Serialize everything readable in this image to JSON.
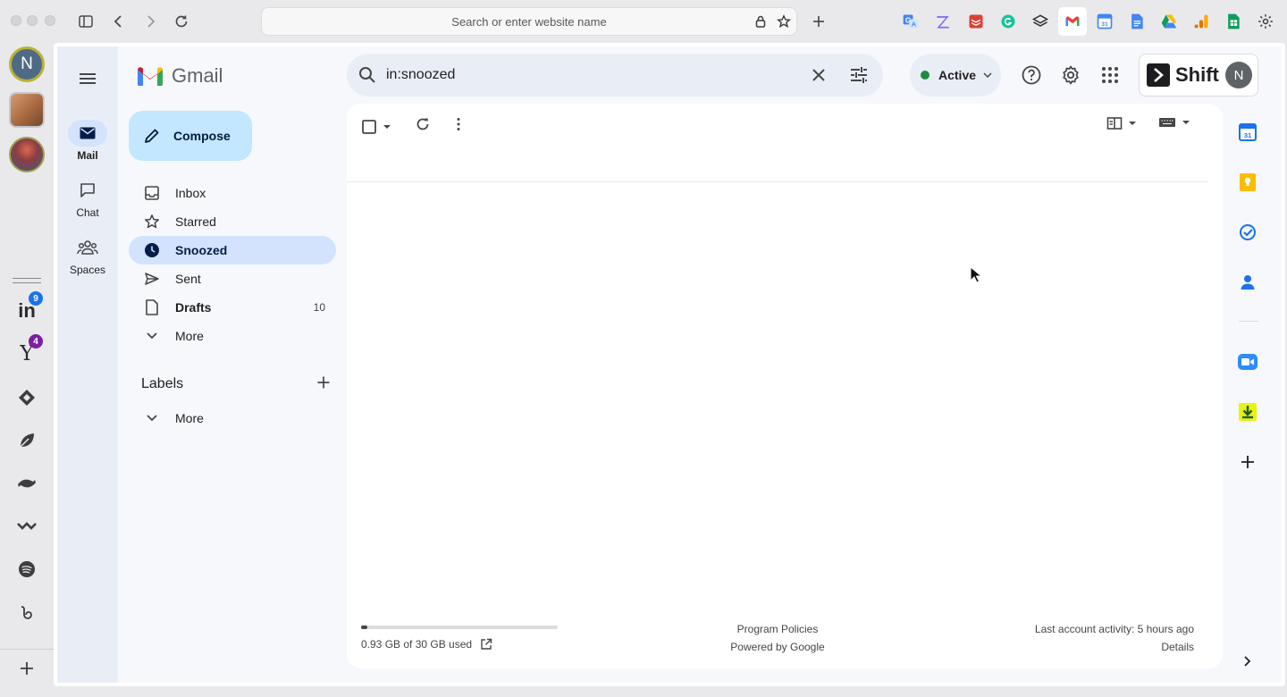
{
  "browser": {
    "url_placeholder": "Search or enter website name",
    "buttons": [
      "sidebar-toggle-icon",
      "back-icon",
      "forward-icon",
      "reload-icon",
      "lock-icon",
      "star-icon",
      "new-tab-icon",
      "settings-icon"
    ],
    "extensions": [
      "translate-icon",
      "clickup-icon",
      "todoist-icon",
      "grammarly-icon",
      "layers-icon",
      "gmail-icon",
      "calendar-icon",
      "docs-icon",
      "drive-icon",
      "analytics-icon",
      "sheets-icon"
    ]
  },
  "shift_rail": {
    "account_initial": "N",
    "apps": [
      {
        "name": "linkedin",
        "text": "in",
        "badge": "9",
        "badge_color": "#1a73e8"
      },
      {
        "name": "yahoo",
        "text": "Y",
        "badge": "4",
        "badge_color": "#7b1fa2"
      }
    ]
  },
  "gmail": {
    "logo_text": "Gmail",
    "app_nav": [
      {
        "label": "Mail"
      },
      {
        "label": "Chat"
      },
      {
        "label": "Spaces"
      }
    ],
    "compose_label": "Compose",
    "folders": [
      {
        "label": "Inbox",
        "count": ""
      },
      {
        "label": "Starred",
        "count": ""
      },
      {
        "label": "Snoozed",
        "count": ""
      },
      {
        "label": "Sent",
        "count": ""
      },
      {
        "label": "Drafts",
        "count": "10"
      },
      {
        "label": "More",
        "count": ""
      }
    ],
    "labels_heading": "Labels",
    "labels_more": "More",
    "search_value": "in:snoozed",
    "status_label": "Active",
    "status_color": "#1e8e3e",
    "shift_brand": "Shift",
    "shift_avatar_initial": "N",
    "footer": {
      "storage_text": "0.93 GB of 30 GB used",
      "storage_fraction": 0.031,
      "program_policies": "Program Policies",
      "powered_by": "Powered by Google",
      "last_activity": "Last account activity: 5 hours ago",
      "details": "Details"
    }
  },
  "colors": {
    "accent": "#0b57d0",
    "compose_bg": "#c2e7ff",
    "selected_folder_bg": "#d3e3fd"
  }
}
